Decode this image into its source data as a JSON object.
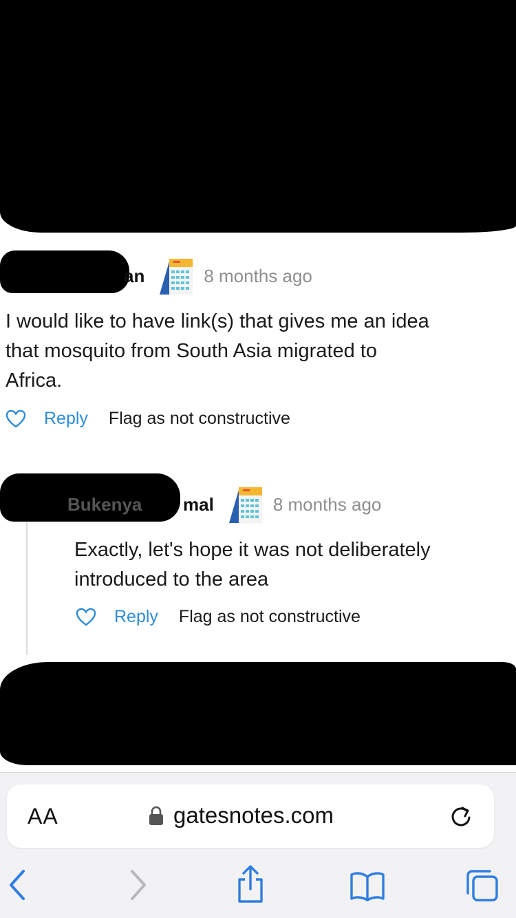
{
  "comments": [
    {
      "author_visible": "an",
      "time": "8 months ago",
      "text_lines": [
        "I would like to have link(s) that gives me an idea",
        "that mosquito from South Asia migrated to",
        "Africa."
      ],
      "reply_label": "Reply",
      "flag_label": "Flag as not constructive"
    },
    {
      "author_visible": "Bukenya",
      "author_visible_end": "mal",
      "time": "8 months ago",
      "text_lines": [
        "Exactly, let's hope it was not deliberately",
        "introduced to the area"
      ],
      "reply_label": "Reply",
      "flag_label": "Flag as not constructive"
    }
  ],
  "browser": {
    "text_size_label": "AA",
    "url": "gatesnotes.com",
    "icons": [
      "lock-icon",
      "reload-icon",
      "back-icon",
      "forward-icon",
      "share-icon",
      "bookmarks-icon",
      "tabs-icon"
    ]
  },
  "colors": {
    "link": "#2f8cd8",
    "muted": "#8e8e8e",
    "toolbar_bg": "#f2f2f4"
  }
}
